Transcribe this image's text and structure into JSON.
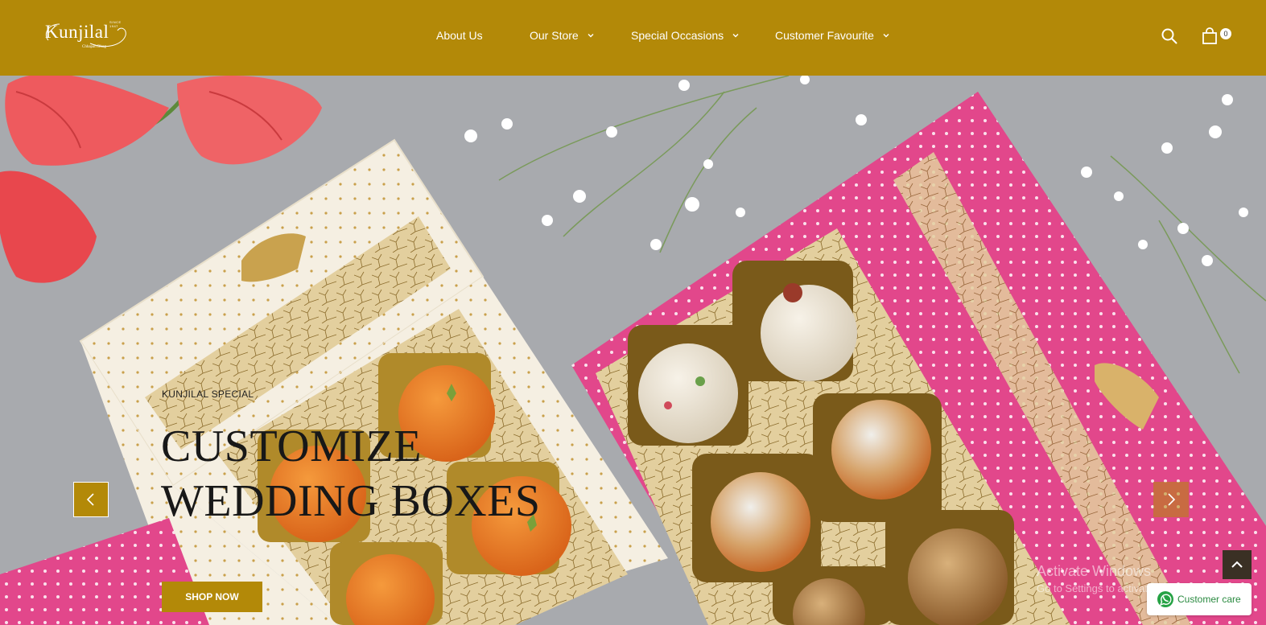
{
  "brand": {
    "name": "Kunjilal",
    "since": "SINCE 1947",
    "tagline": "Chhapan Bhog"
  },
  "nav": {
    "items": [
      {
        "label": "About Us",
        "has_dropdown": false
      },
      {
        "label": "Our Store",
        "has_dropdown": true
      },
      {
        "label": "Special Occasions",
        "has_dropdown": true
      },
      {
        "label": "Customer Favourite",
        "has_dropdown": true
      }
    ]
  },
  "header": {
    "search_icon": "search-icon",
    "cart_icon": "shopping-bag-icon",
    "cart_count": "0"
  },
  "hero": {
    "eyebrow": "KUNJILAL SPECIAL",
    "headline_line1": "CUSTOMIZE",
    "headline_line2": "WEDDING BOXES",
    "cta_label": "SHOP NOW",
    "prev_icon": "chevron-left-icon",
    "next_icon": "chevron-right-icon"
  },
  "overlay": {
    "windows_activate_line1": "Activate Windows",
    "windows_activate_line2": "Go to Settings to activate Windows.",
    "scroll_top_icon": "chevron-up-icon",
    "customer_care_label": "Customer care",
    "customer_care_icon": "whatsapp-icon"
  },
  "colors": {
    "brand_gold": "#b38908",
    "hero_bg": "#a8aaae",
    "pink_box": "#e2478b",
    "cream_box": "#f3ede0",
    "ladoo_orange": "#e9781f"
  }
}
